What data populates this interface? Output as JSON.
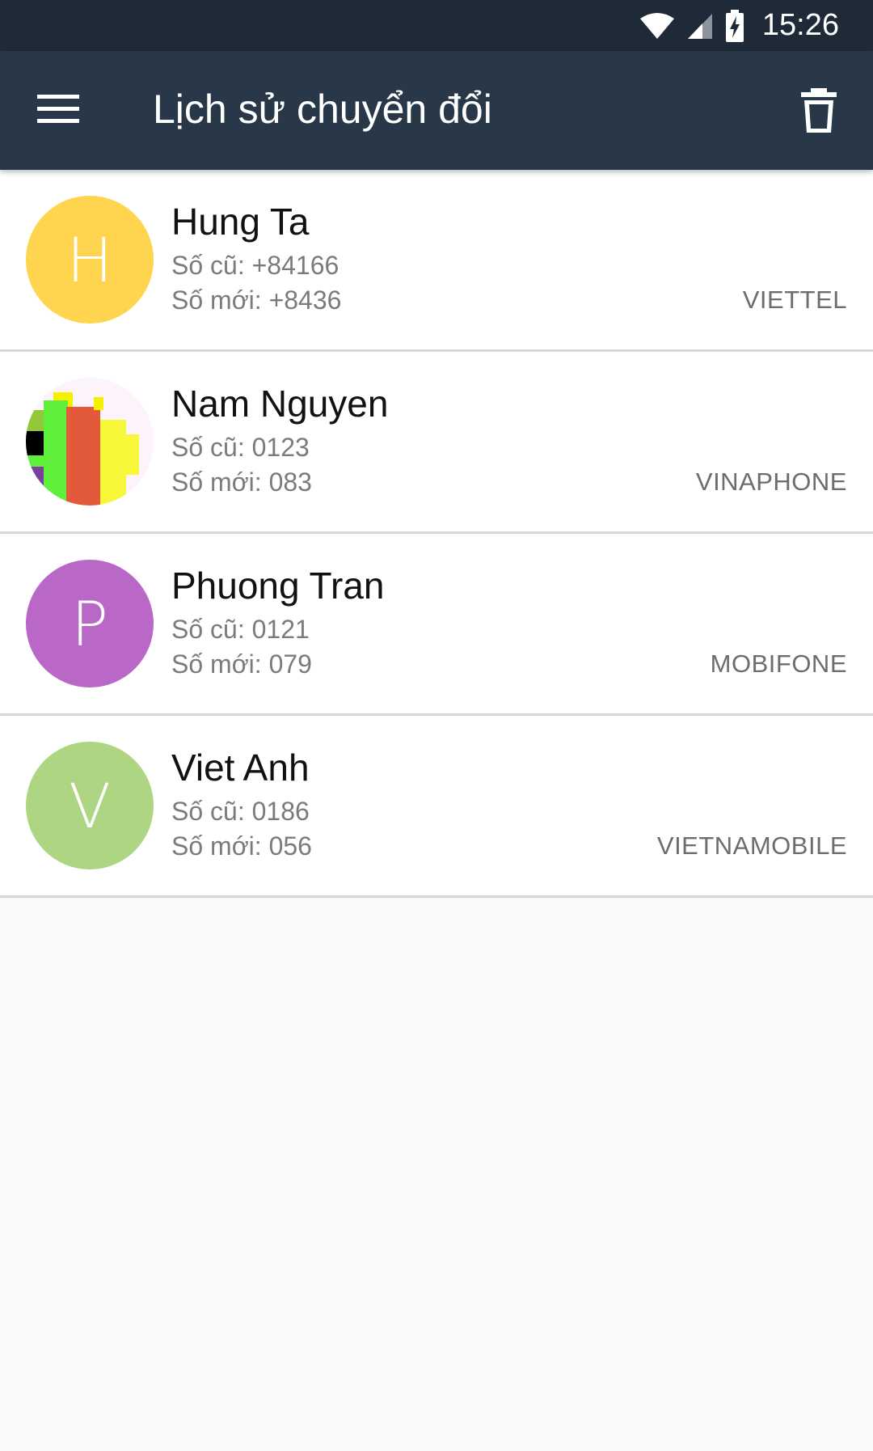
{
  "status_bar": {
    "time": "15:26",
    "icons": [
      "wifi-icon",
      "signal-icon",
      "battery-charging-icon"
    ]
  },
  "app_bar": {
    "title": "Lịch sử chuyển đổi",
    "menu_icon": "hamburger-menu-icon",
    "delete_icon": "trash-icon"
  },
  "contacts": [
    {
      "initial": "H",
      "avatar_color": "#ffd54f",
      "name": "Hung Ta",
      "old_number": "Số cũ: +84166",
      "new_number": "Số mới: +8436",
      "carrier": "VIETTEL"
    },
    {
      "initial": "",
      "avatar_color": "#fdf3fb",
      "avatar_type": "photo",
      "name": "Nam Nguyen",
      "old_number": "Số cũ: 0123",
      "new_number": "Số mới: 083",
      "carrier": "VINAPHONE"
    },
    {
      "initial": "P",
      "avatar_color": "#ba68c8",
      "name": "Phuong Tran",
      "old_number": "Số cũ: 0121",
      "new_number": "Số mới: 079",
      "carrier": "MOBIFONE"
    },
    {
      "initial": "V",
      "avatar_color": "#aed581",
      "name": "Viet Anh",
      "old_number": "Số cũ: 0186",
      "new_number": "Số mới: 056",
      "carrier": "VIETNAMOBILE"
    }
  ],
  "colors": {
    "status_bar": "#1e2a38",
    "app_bar": "#283849",
    "background": "#fafafa",
    "divider": "#d7d7d7"
  }
}
